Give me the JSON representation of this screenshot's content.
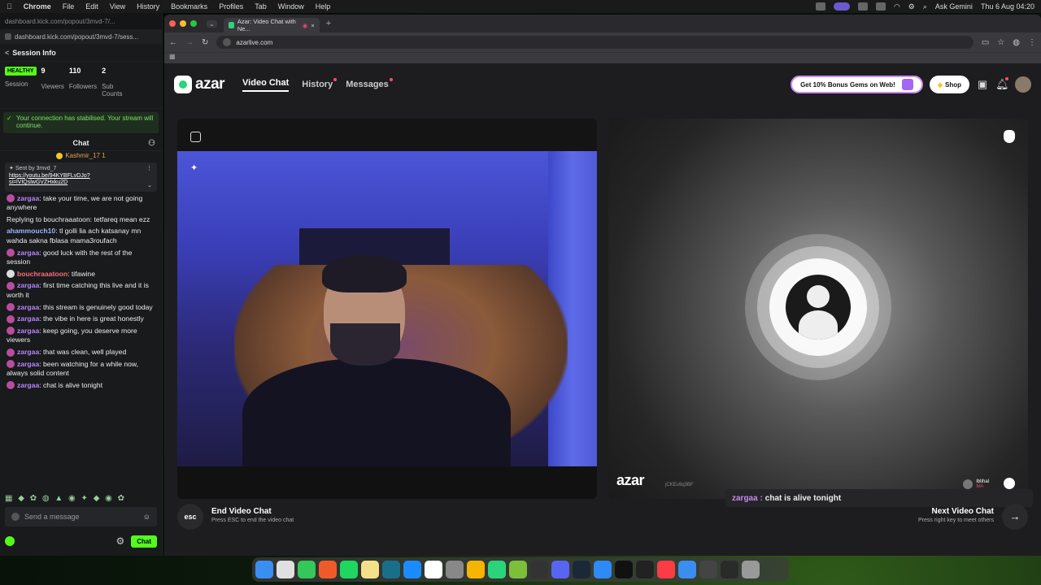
{
  "menubar": {
    "app": "Chrome",
    "items": [
      "File",
      "Edit",
      "View",
      "History",
      "Bookmarks",
      "Profiles",
      "Tab",
      "Window",
      "Help"
    ],
    "ask_gemini": "Ask Gemini",
    "clock": "Thu 6 Aug 04:20"
  },
  "kick": {
    "window_title": "dashboard.kick.com/popout/3mvd-7/...",
    "url": "dashboard.kick.com/popout/3mvd-7/sess...",
    "session_title": "Session Info",
    "status_badge": "HEALTHY",
    "stats": [
      {
        "num": "9",
        "label": "Viewers"
      },
      {
        "num": "110",
        "label": "Followers"
      },
      {
        "num": "2",
        "label": "Sub Counts"
      }
    ],
    "session_label": "Session",
    "stable_msg": "Your connection has stabilised. Your stream will continue.",
    "chat_title": "Chat",
    "pinned_top_user": "Kashmir_17",
    "pinned_top_count": "1",
    "pinned_sentby": "Sent by",
    "pinned_author": "3mvd_7",
    "pinned_link": "https://youtu.be/94KYBFLvDJo?si=lVIQslwGVZHxku2D",
    "messages": [
      {
        "user": "zargaa",
        "color": "#b984ff",
        "text": ": take your time, we are not going anywhere"
      },
      {
        "reply": "Replying to bouchraaatoon: tetfareq mean ezz"
      },
      {
        "user": "ahammouch10",
        "color": "#9bb6ff",
        "text": ": tl golli lia ach katsanay mn wahda sakna fblasa mama3roufach"
      },
      {
        "user": "zargaa",
        "color": "#b984ff",
        "text": ": good luck with the rest of the session"
      },
      {
        "user": "bouchraaatoon",
        "color": "#ff6b7a",
        "text": ": tifawine"
      },
      {
        "user": "zargaa",
        "color": "#b984ff",
        "text": ": first time catching this live and it is worth it"
      },
      {
        "user": "zargaa",
        "color": "#b984ff",
        "text": ": this stream is genuinely good today"
      },
      {
        "user": "zargaa",
        "color": "#b984ff",
        "text": ": the vibe in here is great honestly"
      },
      {
        "user": "zargaa",
        "color": "#b984ff",
        "text": ": keep going, you deserve more viewers"
      },
      {
        "user": "zargaa",
        "color": "#b984ff",
        "text": ": that was clean, well played"
      },
      {
        "user": "zargaa",
        "color": "#b984ff",
        "text": ": been watching for a while now, always solid content"
      },
      {
        "user": "zargaa",
        "color": "#b984ff",
        "text": ": chat is alive tonight"
      }
    ],
    "input_placeholder": "Send a message",
    "chat_button": "Chat"
  },
  "browser": {
    "tab_title": "Azar: Video Chat with Ne...",
    "url": "azarlive.com"
  },
  "azar": {
    "logo": "azar",
    "nav": [
      {
        "label": "Video Chat",
        "active": true
      },
      {
        "label": "History",
        "dot": true
      },
      {
        "label": "Messages",
        "dot": true
      }
    ],
    "promo": "Get 10% Bonus Gems on Web!",
    "shop": "Shop",
    "remote_logo": "azar",
    "remote_id": "jCKEu9q3BF",
    "peer_name": "lbtihal",
    "peer_country": "MA",
    "end_title": "End Video Chat",
    "end_sub": "Press ESC to end the video chat",
    "esc": "esc",
    "last_user": "zargaa :",
    "last_text": "chat is alive tonight",
    "next_title": "Next Video Chat",
    "next_sub": "Press right key to meet others"
  }
}
